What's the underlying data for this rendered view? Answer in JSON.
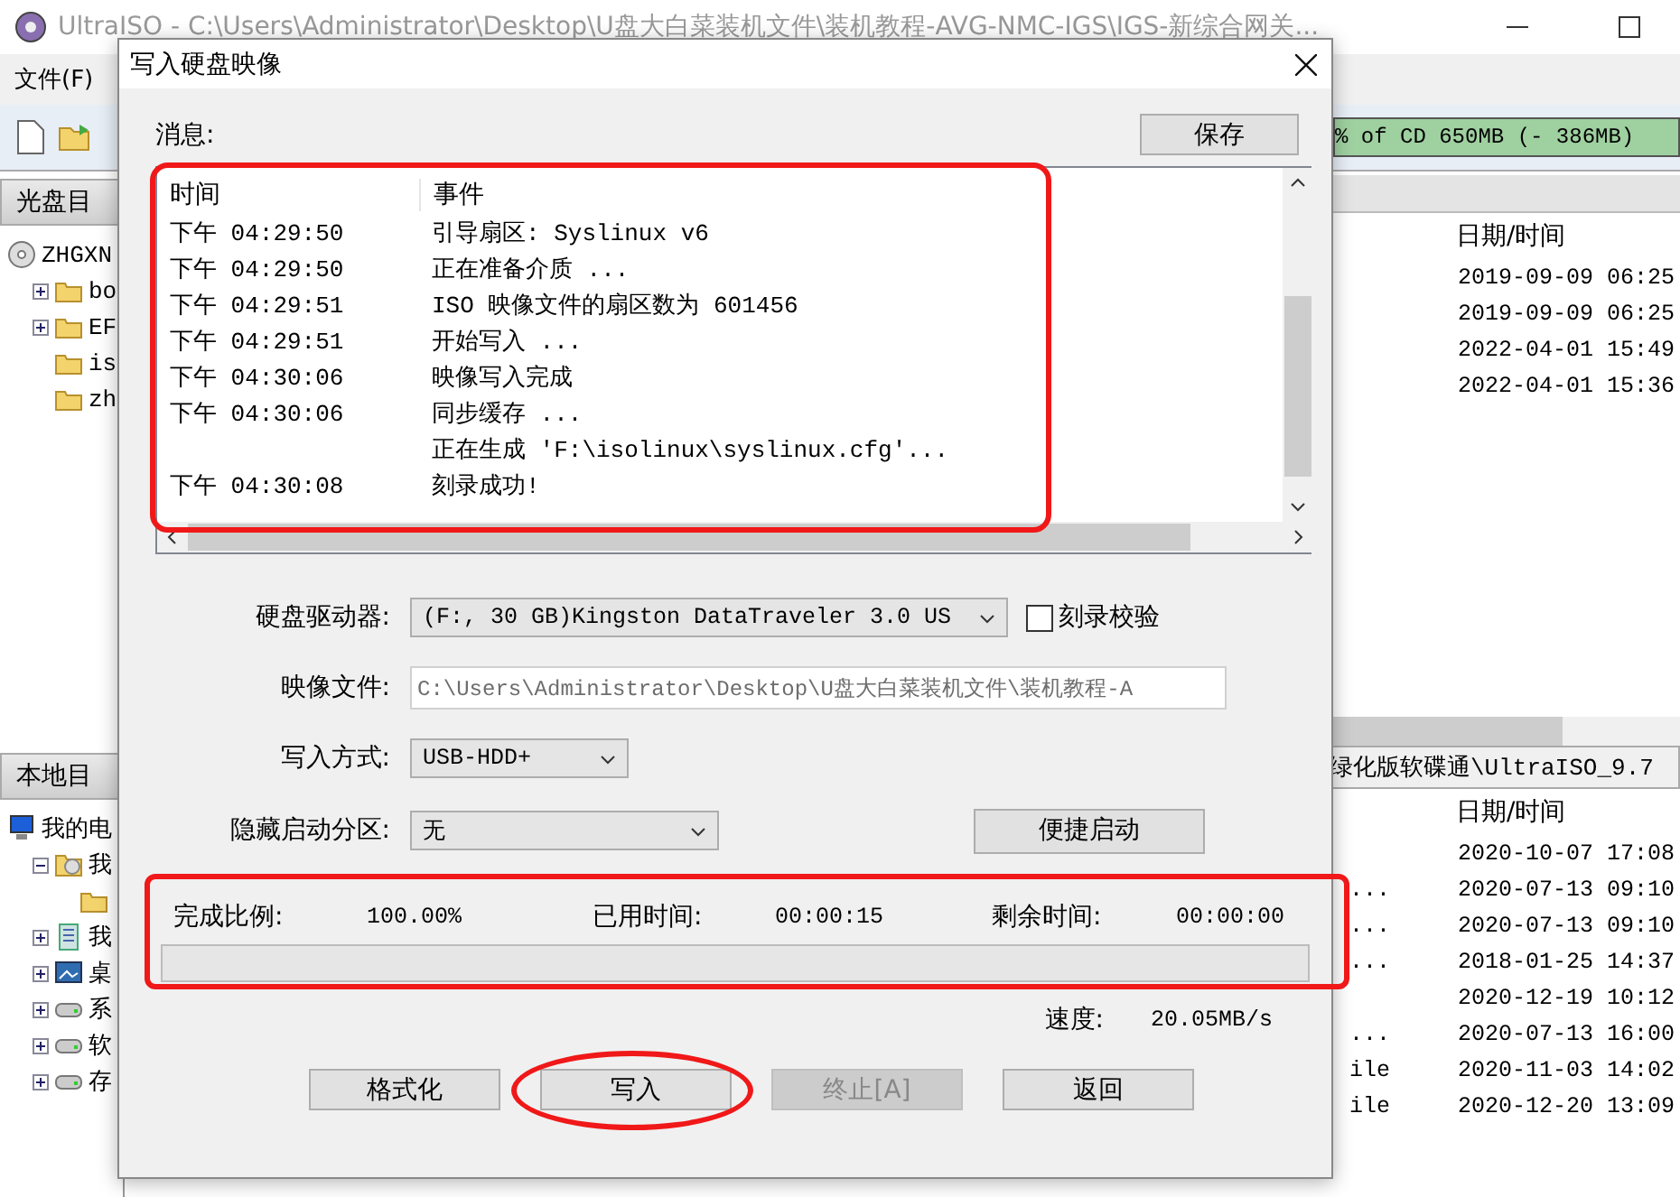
{
  "window": {
    "title": "UltraISO - C:\\Users\\Administrator\\Desktop\\U盘大白菜装机文件\\装机教程-AVG-NMC-IGS\\IGS-新综合网关..."
  },
  "menu": [
    "文件(F)"
  ],
  "toolbar": {
    "capacity": "% of CD 650MB (- 386MB)"
  },
  "cd_pane": {
    "header": "光盘目",
    "tree": [
      {
        "label": "ZHGXN",
        "kind": "disc",
        "children": [
          {
            "label": "bo",
            "kind": "folder",
            "expanded": false
          },
          {
            "label": "EF",
            "kind": "folder",
            "expanded": false
          },
          {
            "label": "is",
            "kind": "folder"
          },
          {
            "label": "zh",
            "kind": "folder"
          }
        ]
      }
    ]
  },
  "local_pane": {
    "header": "本地目",
    "tree": [
      {
        "label": "我的电",
        "kind": "computer",
        "children": [
          {
            "label": "我",
            "kind": "discfolder",
            "expanded": true,
            "children": [
              {
                "kind": "folder"
              }
            ]
          },
          {
            "label": "我",
            "kind": "documents",
            "expanded": false
          },
          {
            "label": "桌",
            "kind": "desktop",
            "expanded": false
          },
          {
            "label": "系",
            "kind": "drive",
            "expanded": false
          },
          {
            "label": "软",
            "kind": "drive",
            "expanded": false
          },
          {
            "label": "存",
            "kind": "drive",
            "expanded": false
          }
        ]
      }
    ]
  },
  "cd_files": {
    "date_header": "日期/时间",
    "rows": [
      {
        "date": "2019-09-09 06:25"
      },
      {
        "date": "2019-09-09 06:25"
      },
      {
        "date": "2022-04-01 15:49"
      },
      {
        "date": "2022-04-01 15:36"
      }
    ]
  },
  "local_files": {
    "path": "绿化版软碟通\\UltraISO_9.7",
    "date_header": "日期/时间",
    "rows": [
      {
        "date": "2020-10-07 17:08"
      },
      {
        "column_1": "...",
        "date": "2020-07-13 09:10"
      },
      {
        "column_1": "...",
        "date": "2020-07-13 09:10"
      },
      {
        "column_1": "...",
        "date": "2018-01-25 14:37"
      },
      {
        "date": "2020-12-19 10:12"
      },
      {
        "column_1": "...",
        "date": "2020-07-13 16:00"
      },
      {
        "column_1": "ile",
        "date": "2020-11-03 14:02"
      },
      {
        "column_1": "ile",
        "date": "2020-12-20 13:09"
      }
    ]
  },
  "dialog": {
    "title": "写入硬盘映像",
    "messages_label": "消息:",
    "save_button": "保存",
    "log": {
      "columns": [
        "时间",
        "事件"
      ],
      "rows": [
        {
          "time": "下午 04:29:50",
          "event": "引导扇区: Syslinux v6"
        },
        {
          "time": "下午 04:29:50",
          "event": "正在准备介质 ..."
        },
        {
          "time": "下午 04:29:51",
          "event": "ISO 映像文件的扇区数为 601456"
        },
        {
          "time": "下午 04:29:51",
          "event": "开始写入 ..."
        },
        {
          "time": "下午 04:30:06",
          "event": "映像写入完成"
        },
        {
          "time": "下午 04:30:06",
          "event": "同步缓存 ..."
        },
        {
          "event": "正在生成 'F:\\isolinux\\syslinux.cfg'..."
        },
        {
          "time": "下午 04:30:08",
          "event": "刻录成功!"
        }
      ]
    },
    "drive": {
      "label": "硬盘驱动器:",
      "value": "(F:, 30 GB)Kingston DataTraveler 3.0 US"
    },
    "verify": {
      "label": "刻录校验",
      "checked": false
    },
    "image_file": {
      "label": "映像文件:",
      "disabled": true,
      "value": "C:\\Users\\Administrator\\Desktop\\U盘大白菜装机文件\\装机教程-A"
    },
    "write_mode": {
      "label": "写入方式:",
      "value": "USB-HDD+"
    },
    "hidden_partition": {
      "label": "隐藏启动分区:",
      "value": "无"
    },
    "quick_boot_button": "便捷启动",
    "progress": {
      "done_label": "完成比例:",
      "done": "100.00%",
      "elapsed_label": "已用时间:",
      "elapsed": "00:00:15",
      "remaining_label": "剩余时间:",
      "remaining": "00:00:00",
      "level": 0
    },
    "speed": {
      "label": "速度:",
      "value": "20.05MB/s"
    },
    "buttons": [
      {
        "label": "格式化",
        "disabled": false
      },
      {
        "label": "写入",
        "disabled": false
      },
      {
        "label": "终止[A]",
        "disabled": true
      },
      {
        "label": "返回",
        "disabled": false
      }
    ]
  }
}
